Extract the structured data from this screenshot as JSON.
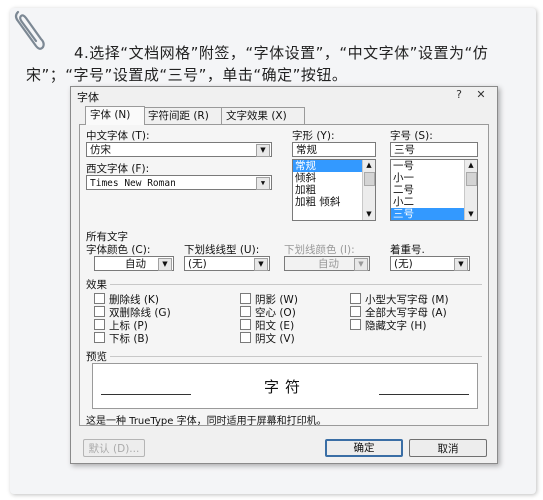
{
  "instruction": "4.选择“文档网格”附签，“字体设置”，“中文字体”设置为“仿宋”；“字号”设置成“三号”，单击“确定”按钮。",
  "dialog": {
    "title": "字体",
    "title_buttons": {
      "help": "?",
      "close": "✕"
    },
    "tabs": [
      "字体 (N)",
      "字符间距 (R)",
      "文字效果 (X)"
    ],
    "chinese_font": {
      "label": "中文字体 (T):",
      "value": "仿宋"
    },
    "western_font": {
      "label": "西文字体 (F):",
      "value": "Times New Roman"
    },
    "style": {
      "label": "字形 (Y):",
      "value": "常规",
      "items": [
        "常规",
        "倾斜",
        "加粗",
        "加粗 倾斜"
      ],
      "selected": "常规"
    },
    "size": {
      "label": "字号 (S):",
      "value": "三号",
      "items": [
        "一号",
        "小一",
        "二号",
        "小二",
        "三号"
      ],
      "selected": "三号"
    },
    "all_text": {
      "heading": "所有文字",
      "font_color": {
        "label": "字体颜色 (C):",
        "value": "自动"
      },
      "underline_type": {
        "label": "下划线线型 (U):",
        "value": "(无)"
      },
      "underline_color": {
        "label": "下划线颜色 (I):",
        "value": "自动"
      },
      "emphasis": {
        "label": "着重号.",
        "value": "(无)"
      }
    },
    "effects": {
      "heading": "效果",
      "col1": [
        "删除线 (K)",
        "双删除线 (G)",
        "上标 (P)",
        "下标 (B)"
      ],
      "col2": [
        "阴影 (W)",
        "空心 (O)",
        "阳文 (E)",
        "阴文 (V)"
      ],
      "col3": [
        "小型大写字母 (M)",
        "全部大写字母 (A)",
        "隐藏文字 (H)"
      ]
    },
    "preview": {
      "heading": "预览",
      "sample": "字符"
    },
    "note": "这是一种 TrueType 字体，同时适用于屏幕和打印机。",
    "buttons": {
      "default": "默认 (D)...",
      "ok": "确定",
      "cancel": "取消"
    }
  }
}
